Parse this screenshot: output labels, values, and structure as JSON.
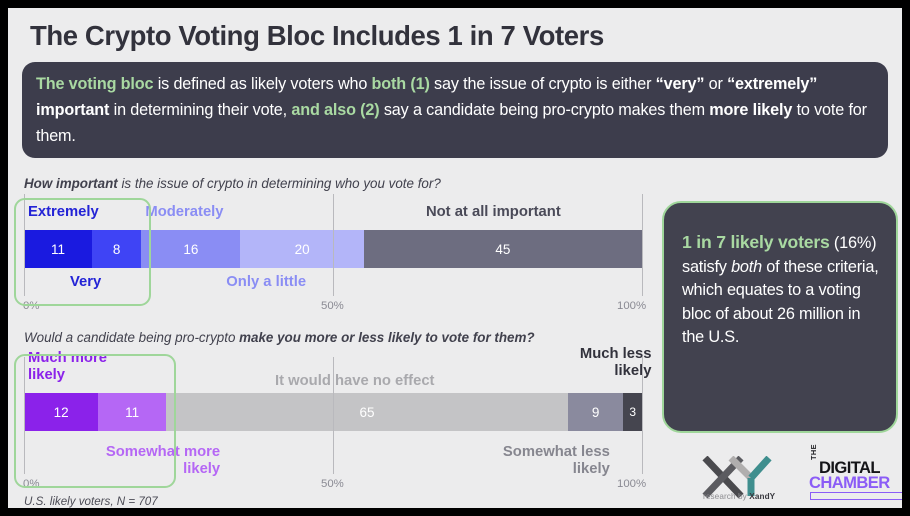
{
  "title": "The Crypto Voting Bloc Includes 1 in 7 Voters",
  "definition": {
    "seg1": "The voting bloc",
    "seg2": " is defined as likely voters who ",
    "seg3": "both (1)",
    "seg4": " say the issue of crypto is either ",
    "seg5": "“very”",
    "seg6": " or ",
    "seg7": "“extremely” important",
    "seg8": " in determining their vote, ",
    "seg9": "and also (2)",
    "seg10": " say a candidate being pro-crypto makes them ",
    "seg11": "more likely",
    "seg12": " to vote for them."
  },
  "chart_data": [
    {
      "type": "bar",
      "orientation": "horizontal-stacked",
      "title": "How important is the issue of crypto in determining who you vote for?",
      "title_bold_prefix": "How important",
      "title_rest": " is the issue of crypto in determining who you vote for?",
      "categories": [
        "Extremely",
        "Very",
        "Moderately",
        "Only a little",
        "Not at all important"
      ],
      "values": [
        11,
        8,
        16,
        20,
        45
      ],
      "colors": [
        "#1a1ae0",
        "#3f44f5",
        "#8a8df4",
        "#b3b5f9",
        "#6d6d80"
      ],
      "label_colors": [
        "#2323d6",
        "#2323d6",
        "#8a8df4",
        "#8a8df4",
        "#4a4a58"
      ],
      "label_positions": [
        "above",
        "below",
        "above",
        "below",
        "above"
      ],
      "xlabel": "",
      "ylabel": "",
      "xlim": [
        0,
        100
      ],
      "ticks": [
        "0%",
        "50%",
        "100%"
      ],
      "highlight_categories": [
        "Extremely",
        "Very"
      ]
    },
    {
      "type": "bar",
      "orientation": "horizontal-stacked",
      "title": "Would a candidate being pro-crypto make you more or less likely to vote for them?",
      "title_bold_prefix": "Would a candidate being pro-crypto ",
      "title_rest": "make you more or less likely to vote for them?",
      "categories": [
        "Much more likely",
        "Somewhat more likely",
        "It would have no effect",
        "Somewhat less likely",
        "Much less likely"
      ],
      "values": [
        12,
        11,
        65,
        9,
        3
      ],
      "colors": [
        "#8b22ea",
        "#b567f5",
        "#c4c4c6",
        "#8a8a9e",
        "#45454f"
      ],
      "label_colors": [
        "#8b22ea",
        "#b567f5",
        "#a9a9ad",
        "#86868f",
        "#32323c"
      ],
      "label_positions": [
        "above",
        "below",
        "above",
        "below",
        "above"
      ],
      "xlabel": "",
      "ylabel": "",
      "xlim": [
        0,
        100
      ],
      "ticks": [
        "0%",
        "50%",
        "100%"
      ],
      "highlight_categories": [
        "Much more likely",
        "Somewhat more likely"
      ]
    }
  ],
  "callout": {
    "headline": "1 in 7 likely voters",
    "line_a": " (16%) satisfy ",
    "line_b": "both",
    "line_c": " of these criteria, which equates to a voting bloc of about 26 million in the U.S."
  },
  "footnote": "U.S. likely voters, N = 707",
  "logos": {
    "xy_mark": "XY",
    "xy_sub_prefix": "research by ",
    "xy_sub_brand": "XandY",
    "dc_the": "THE",
    "dc_digital": "DIGITAL",
    "dc_chamber": "CHAMBER"
  },
  "colors": {
    "accent_green": "#9fd69a",
    "dark_panel": "#3d3d4c",
    "page_bg": "#ececed"
  }
}
